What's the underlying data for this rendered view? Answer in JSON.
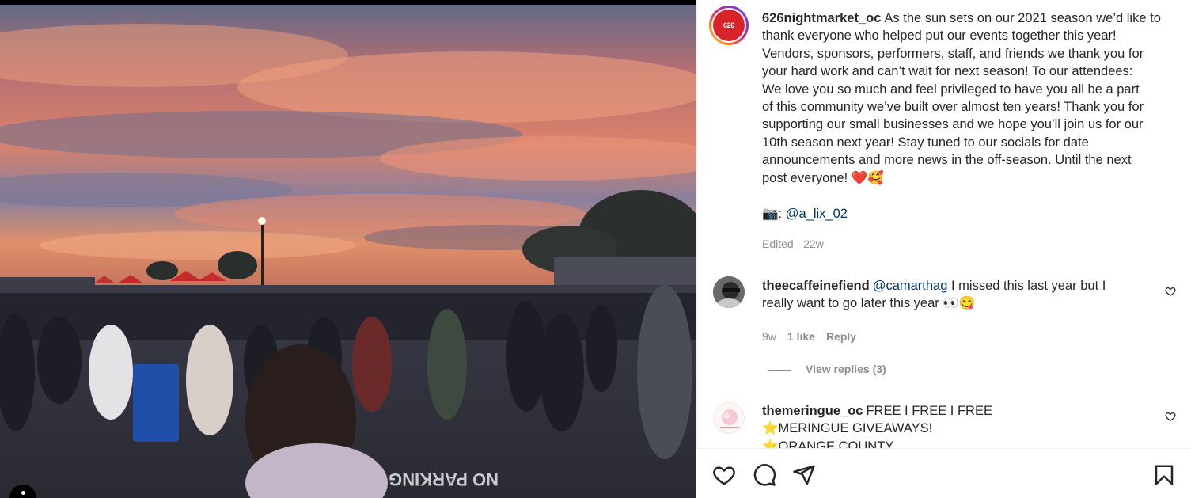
{
  "post": {
    "username": "626nightmarket_oc",
    "avatar_text": "626",
    "caption_lines": [
      "As the sun sets on our 2021 season we’d like to",
      "thank everyone who helped put our events together this year!",
      "Vendors, sponsors, performers, staff, and friends we thank you for",
      "your hard work and can’t wait for next season! To our attendees:",
      "We love you so much and feel privileged to have you all be a part",
      "of this community we’ve built over almost ten years! Thank you for",
      "supporting our small businesses and we hope you’ll join us for our",
      "10th season next year! Stay tuned to our socials for date",
      "announcements and more news in the off-season. Until the next",
      "post everyone! ❤️🥰"
    ],
    "camera_emoji": "📷",
    "camera_separator": ":",
    "photo_credit": "@a_lix_02",
    "edited_text": "Edited · 22w"
  },
  "comments": [
    {
      "username": "theecaffeinefiend",
      "mention": "@camarthag",
      "text_line1": "I missed this last year but I",
      "text_line2": "really want to go later this year 👀😋",
      "time": "9w",
      "likes": "1 like",
      "reply_label": "Reply",
      "view_replies": "View replies (3)"
    },
    {
      "username": "themeringue_oc",
      "text_line1": "FREE I FREE I FREE",
      "text_line2": "⭐MERINGUE GIVEAWAYS!",
      "text_line3": "⭐ORANGE COUNTY"
    }
  ],
  "photo": {
    "ground_text": "NO PARKING"
  },
  "colors": {
    "accent_link": "#00376b",
    "muted": "#8e8e8e",
    "brand_red": "#d8232a"
  },
  "icons": [
    "heart-icon",
    "comment-icon",
    "share-icon",
    "bookmark-icon"
  ]
}
